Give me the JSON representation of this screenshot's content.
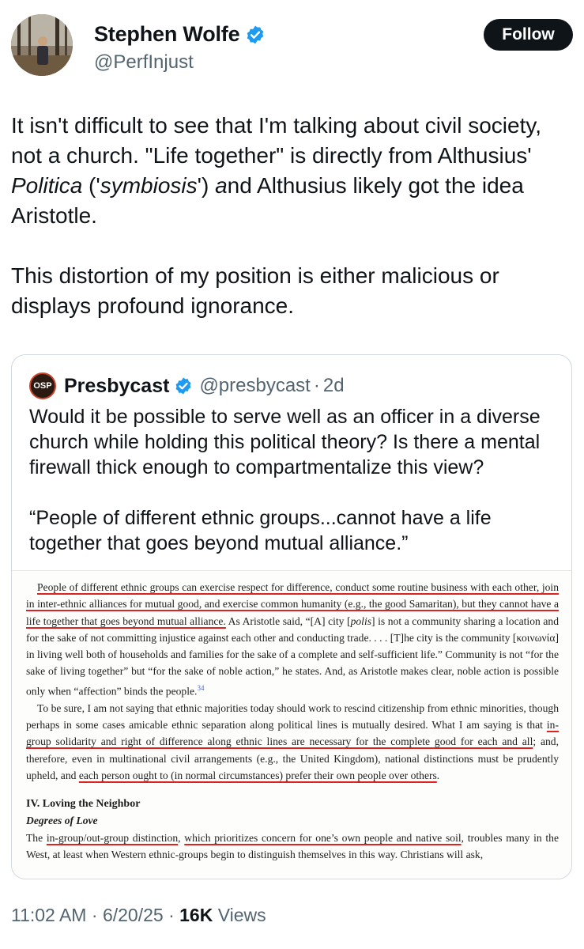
{
  "author": {
    "name": "Stephen Wolfe",
    "handle": "@PerfInjust",
    "verified": true,
    "avatar_icon": "profile-photo-forest"
  },
  "follow_label": "Follow",
  "tweet": {
    "para1_a": "It isn't difficult to see that I'm talking about civil society, not a church. \"Life together\" is directly from Althusius' ",
    "para1_politica": "Politica",
    "para1_b": " ('",
    "para1_symbiosis": "symbiosis",
    "para1_c": "') ",
    "para1_and": "a",
    "para1_d": "nd Althusius likely got the idea Aristotle.",
    "para2": "This distortion of my position is either malicious or displays profound ignorance."
  },
  "quote": {
    "name": "Presbycast",
    "logo_text": "OSP",
    "handle": "@presbycast",
    "dot": "·",
    "age": "2d",
    "para1": "Would it be possible to serve well as an officer in a diverse church while holding this political theory? Is there a mental firewall thick enough to compartmentalize this view?",
    "para2": "“People of different ethnic groups...cannot have a life together that goes beyond mutual alliance.”"
  },
  "excerpt": {
    "p1_u1": "People of different ethnic groups can exercise respect for difference, conduct some routine business with each other, join in inter-ethnic alliances for mutual good, and exercise common humanity (e.g., the good Samaritan), but they cannot have a life together that goes beyond mutual alliance.",
    "p1_rest_a": " As Aristotle said, “[A] city [",
    "p1_polis": "polis",
    "p1_rest_b": "] is not a community sharing a location and for the sake of not committing injustice against each other and conducting trade. . . . [T]he city is the community [κοινωνία] in living well both of households and families for the sake of a complete and self-sufficient life.” Community is not “for the sake of living together” but “for the sake of noble action,” he states. And, as Aristotle makes clear, noble action is possible only when “affection” binds the people.",
    "p1_footnote": "34",
    "p2_a": "To be sure, I am not saying that ethnic majorities today should work to rescind citizenship from ethnic minorities, though perhaps in some cases amicable ethnic separation along political lines is mutually desired. What I am saying is that ",
    "p2_u1": "in-group solidarity and right of difference along ethnic lines are necessary for the complete good for each and all",
    "p2_b": "; and, therefore, even in multinational civil arrangements (e.g., the United Kingdom), national distinctions must be prudently upheld, and ",
    "p2_u2": "each person ought to (in normal circumstances) prefer their own people over others",
    "p2_c": ".",
    "heading": "IV. Loving the Neighbor",
    "subheading": "Degrees of Love",
    "p3_a": "The ",
    "p3_u1": "in-group/out-group distinction",
    "p3_b": ", ",
    "p3_u2": "which prioritizes concern for one’s own people and native soil",
    "p3_c": ", troubles many in the West, at least when Western ethnic-groups begin to distinguish themselves in this way. Christians will ask,"
  },
  "meta": {
    "time": "11:02 AM",
    "sep1": " · ",
    "date": "6/20/25",
    "sep2": " · ",
    "views_count": "16K",
    "views_label": " Views"
  },
  "colors": {
    "accent_verified": "#1d9bf0",
    "text_primary": "#0f1419",
    "text_secondary": "#536471",
    "underline_red": "#dd2222"
  }
}
